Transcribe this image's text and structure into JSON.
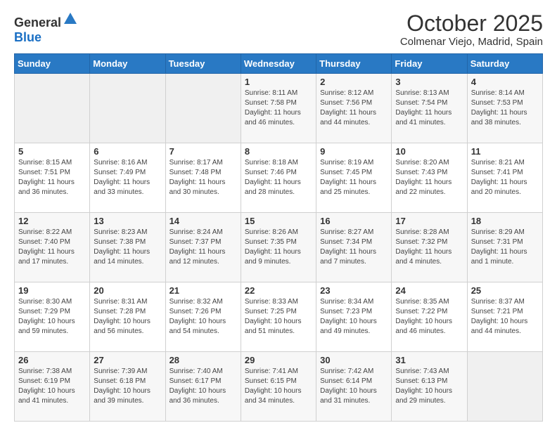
{
  "logo": {
    "general": "General",
    "blue": "Blue"
  },
  "header": {
    "month": "October 2025",
    "location": "Colmenar Viejo, Madrid, Spain"
  },
  "days_of_week": [
    "Sunday",
    "Monday",
    "Tuesday",
    "Wednesday",
    "Thursday",
    "Friday",
    "Saturday"
  ],
  "weeks": [
    [
      {
        "day": "",
        "info": ""
      },
      {
        "day": "",
        "info": ""
      },
      {
        "day": "",
        "info": ""
      },
      {
        "day": "1",
        "info": "Sunrise: 8:11 AM\nSunset: 7:58 PM\nDaylight: 11 hours and 46 minutes."
      },
      {
        "day": "2",
        "info": "Sunrise: 8:12 AM\nSunset: 7:56 PM\nDaylight: 11 hours and 44 minutes."
      },
      {
        "day": "3",
        "info": "Sunrise: 8:13 AM\nSunset: 7:54 PM\nDaylight: 11 hours and 41 minutes."
      },
      {
        "day": "4",
        "info": "Sunrise: 8:14 AM\nSunset: 7:53 PM\nDaylight: 11 hours and 38 minutes."
      }
    ],
    [
      {
        "day": "5",
        "info": "Sunrise: 8:15 AM\nSunset: 7:51 PM\nDaylight: 11 hours and 36 minutes."
      },
      {
        "day": "6",
        "info": "Sunrise: 8:16 AM\nSunset: 7:49 PM\nDaylight: 11 hours and 33 minutes."
      },
      {
        "day": "7",
        "info": "Sunrise: 8:17 AM\nSunset: 7:48 PM\nDaylight: 11 hours and 30 minutes."
      },
      {
        "day": "8",
        "info": "Sunrise: 8:18 AM\nSunset: 7:46 PM\nDaylight: 11 hours and 28 minutes."
      },
      {
        "day": "9",
        "info": "Sunrise: 8:19 AM\nSunset: 7:45 PM\nDaylight: 11 hours and 25 minutes."
      },
      {
        "day": "10",
        "info": "Sunrise: 8:20 AM\nSunset: 7:43 PM\nDaylight: 11 hours and 22 minutes."
      },
      {
        "day": "11",
        "info": "Sunrise: 8:21 AM\nSunset: 7:41 PM\nDaylight: 11 hours and 20 minutes."
      }
    ],
    [
      {
        "day": "12",
        "info": "Sunrise: 8:22 AM\nSunset: 7:40 PM\nDaylight: 11 hours and 17 minutes."
      },
      {
        "day": "13",
        "info": "Sunrise: 8:23 AM\nSunset: 7:38 PM\nDaylight: 11 hours and 14 minutes."
      },
      {
        "day": "14",
        "info": "Sunrise: 8:24 AM\nSunset: 7:37 PM\nDaylight: 11 hours and 12 minutes."
      },
      {
        "day": "15",
        "info": "Sunrise: 8:26 AM\nSunset: 7:35 PM\nDaylight: 11 hours and 9 minutes."
      },
      {
        "day": "16",
        "info": "Sunrise: 8:27 AM\nSunset: 7:34 PM\nDaylight: 11 hours and 7 minutes."
      },
      {
        "day": "17",
        "info": "Sunrise: 8:28 AM\nSunset: 7:32 PM\nDaylight: 11 hours and 4 minutes."
      },
      {
        "day": "18",
        "info": "Sunrise: 8:29 AM\nSunset: 7:31 PM\nDaylight: 11 hours and 1 minute."
      }
    ],
    [
      {
        "day": "19",
        "info": "Sunrise: 8:30 AM\nSunset: 7:29 PM\nDaylight: 10 hours and 59 minutes."
      },
      {
        "day": "20",
        "info": "Sunrise: 8:31 AM\nSunset: 7:28 PM\nDaylight: 10 hours and 56 minutes."
      },
      {
        "day": "21",
        "info": "Sunrise: 8:32 AM\nSunset: 7:26 PM\nDaylight: 10 hours and 54 minutes."
      },
      {
        "day": "22",
        "info": "Sunrise: 8:33 AM\nSunset: 7:25 PM\nDaylight: 10 hours and 51 minutes."
      },
      {
        "day": "23",
        "info": "Sunrise: 8:34 AM\nSunset: 7:23 PM\nDaylight: 10 hours and 49 minutes."
      },
      {
        "day": "24",
        "info": "Sunrise: 8:35 AM\nSunset: 7:22 PM\nDaylight: 10 hours and 46 minutes."
      },
      {
        "day": "25",
        "info": "Sunrise: 8:37 AM\nSunset: 7:21 PM\nDaylight: 10 hours and 44 minutes."
      }
    ],
    [
      {
        "day": "26",
        "info": "Sunrise: 7:38 AM\nSunset: 6:19 PM\nDaylight: 10 hours and 41 minutes."
      },
      {
        "day": "27",
        "info": "Sunrise: 7:39 AM\nSunset: 6:18 PM\nDaylight: 10 hours and 39 minutes."
      },
      {
        "day": "28",
        "info": "Sunrise: 7:40 AM\nSunset: 6:17 PM\nDaylight: 10 hours and 36 minutes."
      },
      {
        "day": "29",
        "info": "Sunrise: 7:41 AM\nSunset: 6:15 PM\nDaylight: 10 hours and 34 minutes."
      },
      {
        "day": "30",
        "info": "Sunrise: 7:42 AM\nSunset: 6:14 PM\nDaylight: 10 hours and 31 minutes."
      },
      {
        "day": "31",
        "info": "Sunrise: 7:43 AM\nSunset: 6:13 PM\nDaylight: 10 hours and 29 minutes."
      },
      {
        "day": "",
        "info": ""
      }
    ]
  ]
}
